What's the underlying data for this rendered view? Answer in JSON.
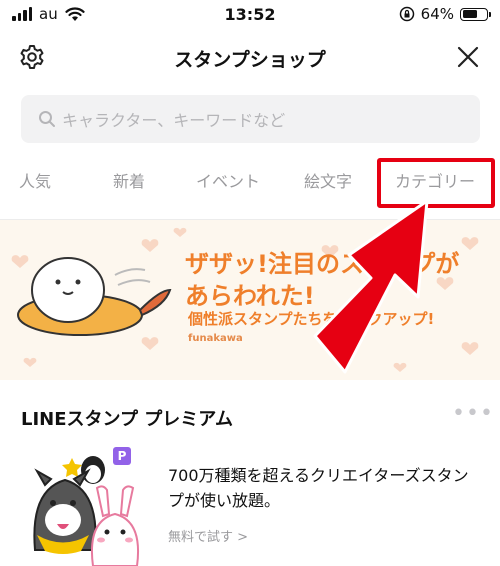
{
  "status_bar": {
    "carrier": "au",
    "time": "13:52",
    "battery": "64%",
    "battery_level": 0.64
  },
  "nav": {
    "title": "スタンプショップ"
  },
  "search": {
    "placeholder": "キャラクター、キーワードなど"
  },
  "tabs": [
    {
      "label": "人気"
    },
    {
      "label": "新着"
    },
    {
      "label": "イベント"
    },
    {
      "label": "絵文字"
    },
    {
      "label": "カテゴリー"
    }
  ],
  "banner": {
    "line1": "ザザッ!注目のスタンプが",
    "line2": "あらわれた!",
    "line3": "個性派スタンプたちをピックアップ!",
    "author": "funakawa"
  },
  "premium": {
    "section_title": "LINEスタンプ プレミアム",
    "badge": "P",
    "description": "700万種類を超えるクリエイターズスタンプが使い放題。",
    "try_link": "無料で試す >"
  },
  "colors": {
    "highlight": "#e60012",
    "banner_text": "#ef7f2b",
    "premium_badge": "#9262e8"
  },
  "icons": [
    "signal-icon",
    "wifi-icon",
    "rotation-lock-icon",
    "battery-icon",
    "gear-icon",
    "close-icon",
    "search-icon",
    "more-icon"
  ]
}
